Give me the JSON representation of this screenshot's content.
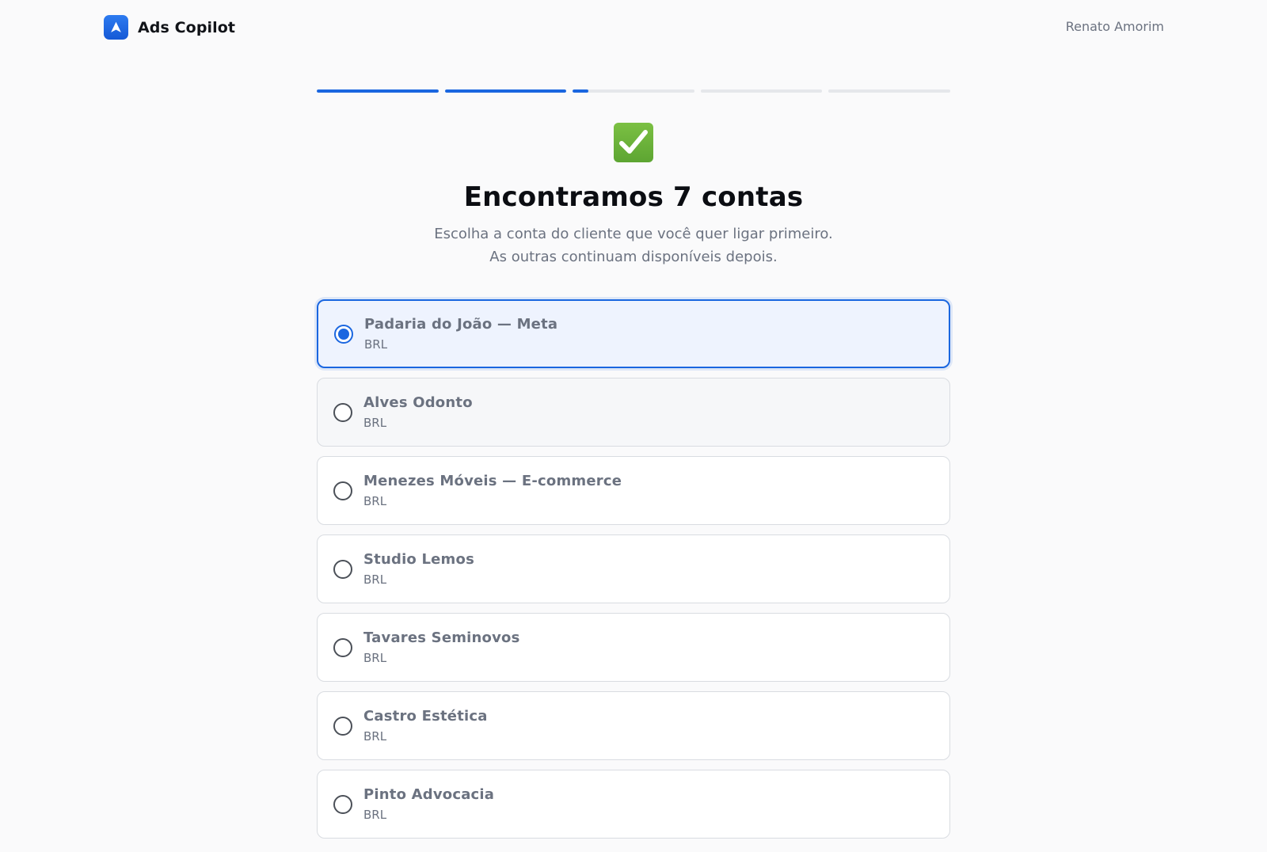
{
  "header": {
    "app_name": "Ads Copilot",
    "user_name": "Renato Amorim",
    "logo_icon": "navigation-arrow-icon",
    "brand_color": "#1a66e0"
  },
  "stepper": {
    "total_steps": 5,
    "step_progress": [
      1,
      1,
      0.13,
      0,
      0
    ]
  },
  "hero": {
    "icon": "check-mark-button-icon",
    "title": "Encontramos 7 contas",
    "subtitle_line1": "Escolha a conta do cliente que você quer ligar primeiro.",
    "subtitle_line2": "As outras continuam disponíveis depois."
  },
  "accounts": [
    {
      "name": "Padaria do João — Meta",
      "currency": "BRL",
      "selected": true
    },
    {
      "name": "Alves Odonto",
      "currency": "BRL",
      "selected": false
    },
    {
      "name": "Menezes Móveis — E-commerce",
      "currency": "BRL",
      "selected": false
    },
    {
      "name": "Studio Lemos",
      "currency": "BRL",
      "selected": false
    },
    {
      "name": "Tavares Seminovos",
      "currency": "BRL",
      "selected": false
    },
    {
      "name": "Castro Estética",
      "currency": "BRL",
      "selected": false
    },
    {
      "name": "Pinto Advocacia",
      "currency": "BRL",
      "selected": false
    }
  ]
}
